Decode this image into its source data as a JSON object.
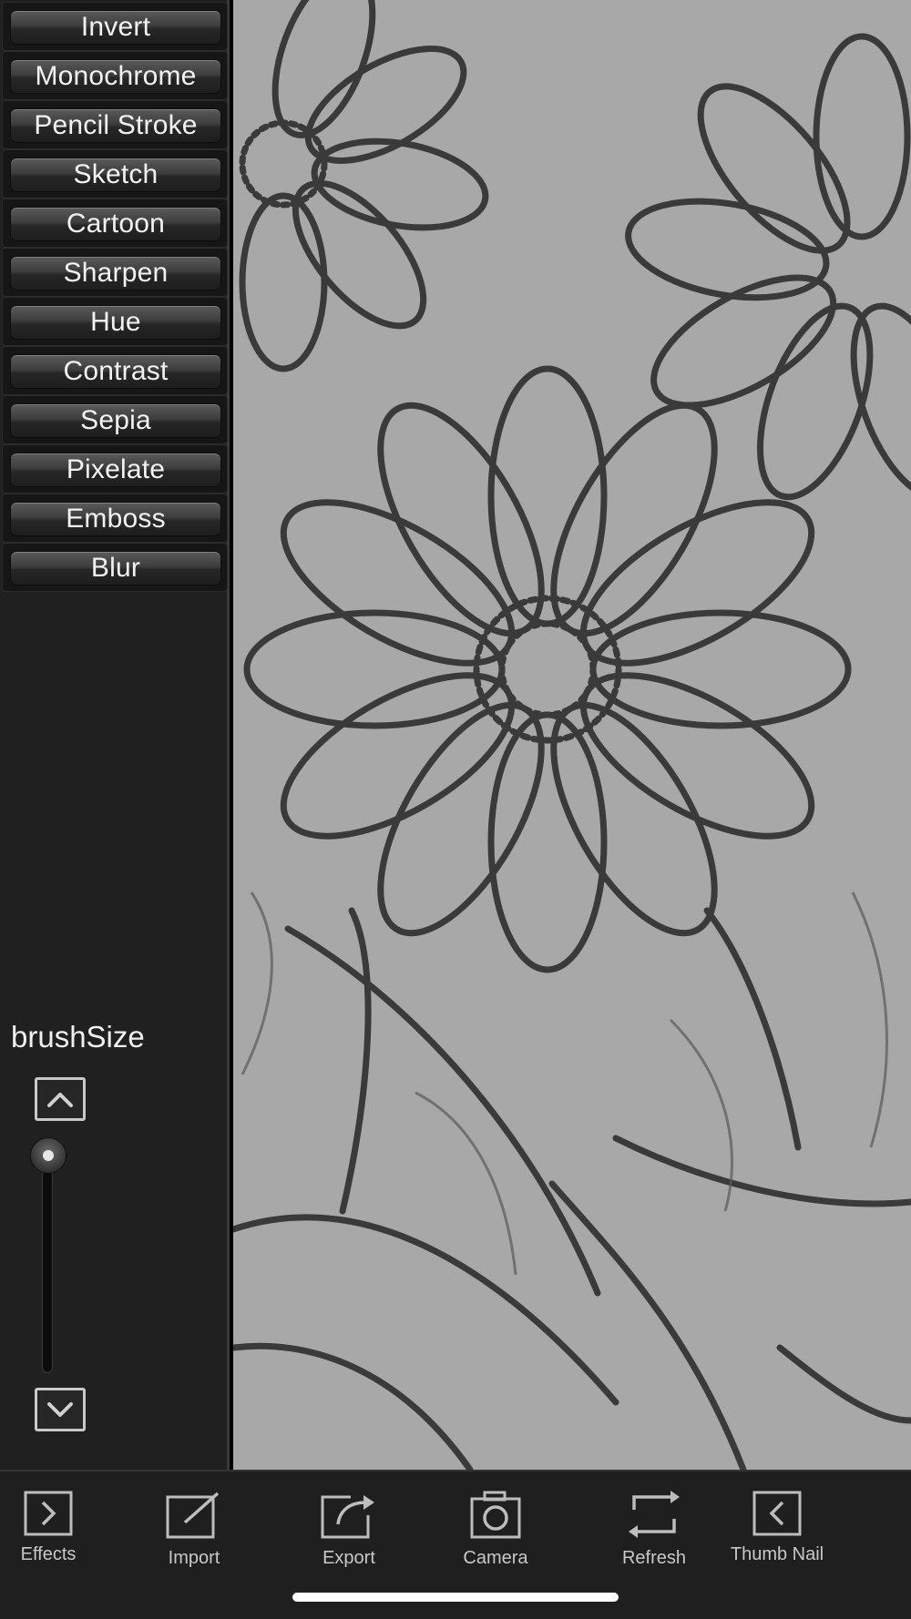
{
  "filters": [
    {
      "label": "Invert"
    },
    {
      "label": "Monochrome"
    },
    {
      "label": "Pencil Stroke"
    },
    {
      "label": "Sketch"
    },
    {
      "label": "Cartoon"
    },
    {
      "label": "Sharpen"
    },
    {
      "label": "Hue"
    },
    {
      "label": "Contrast"
    },
    {
      "label": "Sepia"
    },
    {
      "label": "Pixelate"
    },
    {
      "label": "Emboss"
    },
    {
      "label": "Blur"
    }
  ],
  "brush": {
    "label": "brushSize",
    "level": 1.0
  },
  "toolbar": {
    "effects": "Effects",
    "import": "Import",
    "export": "Export",
    "camera": "Camera",
    "refresh": "Refresh",
    "thumbnail": "Thumb Nail"
  },
  "icons": {
    "effects": "chevron-right-box-icon",
    "import": "edit-box-icon",
    "export": "share-box-icon",
    "camera": "camera-icon",
    "refresh": "refresh-icon",
    "thumbnail": "chevron-left-box-icon"
  },
  "colors": {
    "sidebar_bg": "#202020",
    "canvas_bg": "#a6a6a6",
    "toolbar_bg": "#1f1f1f"
  }
}
